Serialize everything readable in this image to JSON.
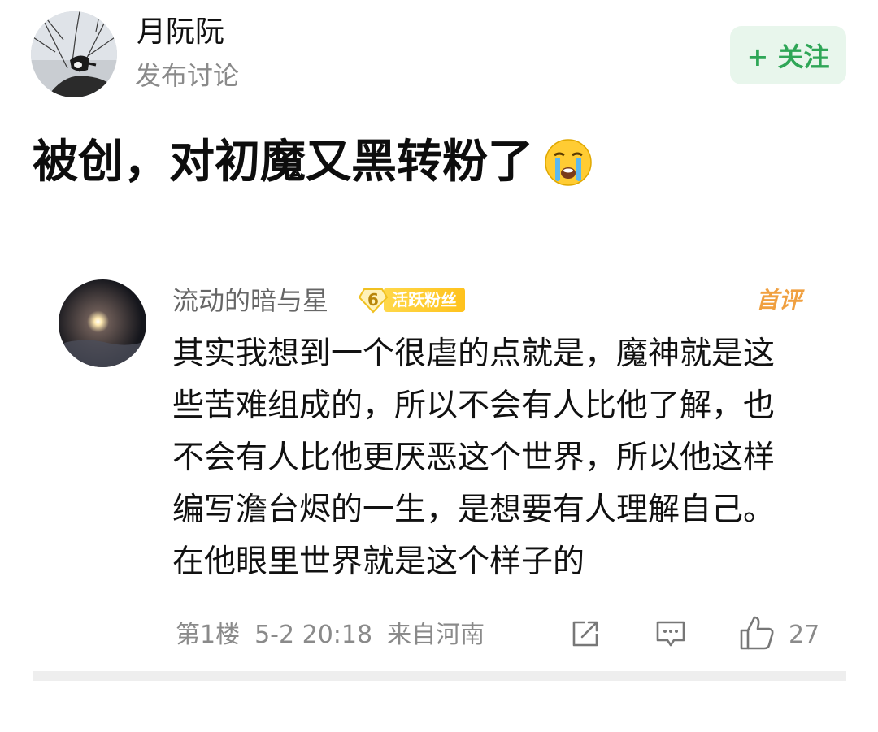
{
  "post": {
    "author": "月阮阮",
    "subtitle": "发布讨论",
    "follow_label": "+ 关注",
    "title": "被创，对初魔又黑转粉了",
    "title_emoji": "crying-face-emoji"
  },
  "comment": {
    "username": "流动的暗与星",
    "fan_level": "6",
    "fan_badge_label": "活跃粉丝",
    "tag": "首评",
    "lines": [
      "其实我想到一个很虐的点就是，魔神就是这",
      "些苦难组成的，所以不会有人比他了解，也",
      "不会有人比他更厌恶这个世界，所以他这样",
      "编写澹台烬的一生，是想要有人理解自己。",
      "在他眼里世界就是这个样子的"
    ],
    "floor": "第1楼",
    "time": "5-2 20:18",
    "location": "来自河南",
    "like_count": "27",
    "icons": {
      "share": "share-icon",
      "reply": "comment-icon",
      "like": "thumbs-up-icon"
    }
  },
  "colors": {
    "follow_bg": "#e8f6ec",
    "follow_text": "#2fa657",
    "badge_yellow": "#ffc21c",
    "tag_orange": "#f0a040",
    "meta_gray": "#8a8a8a"
  }
}
